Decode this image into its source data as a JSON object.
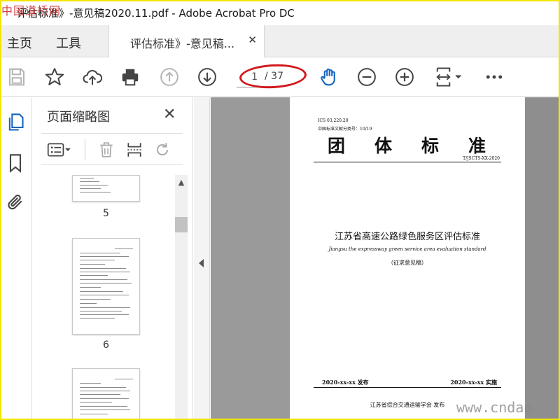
{
  "window": {
    "title": "评估标准》-意见稿2020.11.pdf - Adobe Acrobat Pro DC",
    "watermark_top": "中国道桥网",
    "watermark_bottom": "www.cndao."
  },
  "tabs": {
    "home": "主页",
    "tools": "工具",
    "document": "评估标准》-意见稿...",
    "close_glyph": "✕"
  },
  "toolbar": {
    "icons": [
      "save-icon",
      "star-icon",
      "upload-cloud-icon",
      "print-icon",
      "arrow-up-icon",
      "arrow-down-icon",
      "hand-icon",
      "zoom-out-icon",
      "zoom-in-icon",
      "page-fit-icon",
      "more-icon"
    ],
    "page_current": "1",
    "page_total": "/ 37",
    "accent": "#1565c0",
    "highlight_color": "#d0191e"
  },
  "sidebar": {
    "icons": [
      "pages-icon",
      "bookmark-icon",
      "attachment-icon"
    ]
  },
  "thumbnails_panel": {
    "title": "页面缩略图",
    "close_glyph": "✕",
    "tool_icons": [
      "options-icon",
      "trash-icon",
      "insert-page-icon",
      "rotate-icon"
    ],
    "pages": [
      "5",
      "6"
    ]
  },
  "document_page": {
    "ics": "ICS 03.220.20",
    "classification": "中国标准文献分类号：10/19",
    "title_chars": [
      "团",
      "体",
      "标",
      "准"
    ],
    "code": "T/JSCTS-XX-2020",
    "heading": "江苏省高速公路绿色服务区评估标准",
    "english_title": "Jiangsu the expressway green service area evaluation standard",
    "draft_note": "（征求意见稿）",
    "publish_date": "2020-xx-xx 发布",
    "implement_date": "2020-xx-xx 实施",
    "organization": "江苏省综合交通运输学会    发布"
  }
}
